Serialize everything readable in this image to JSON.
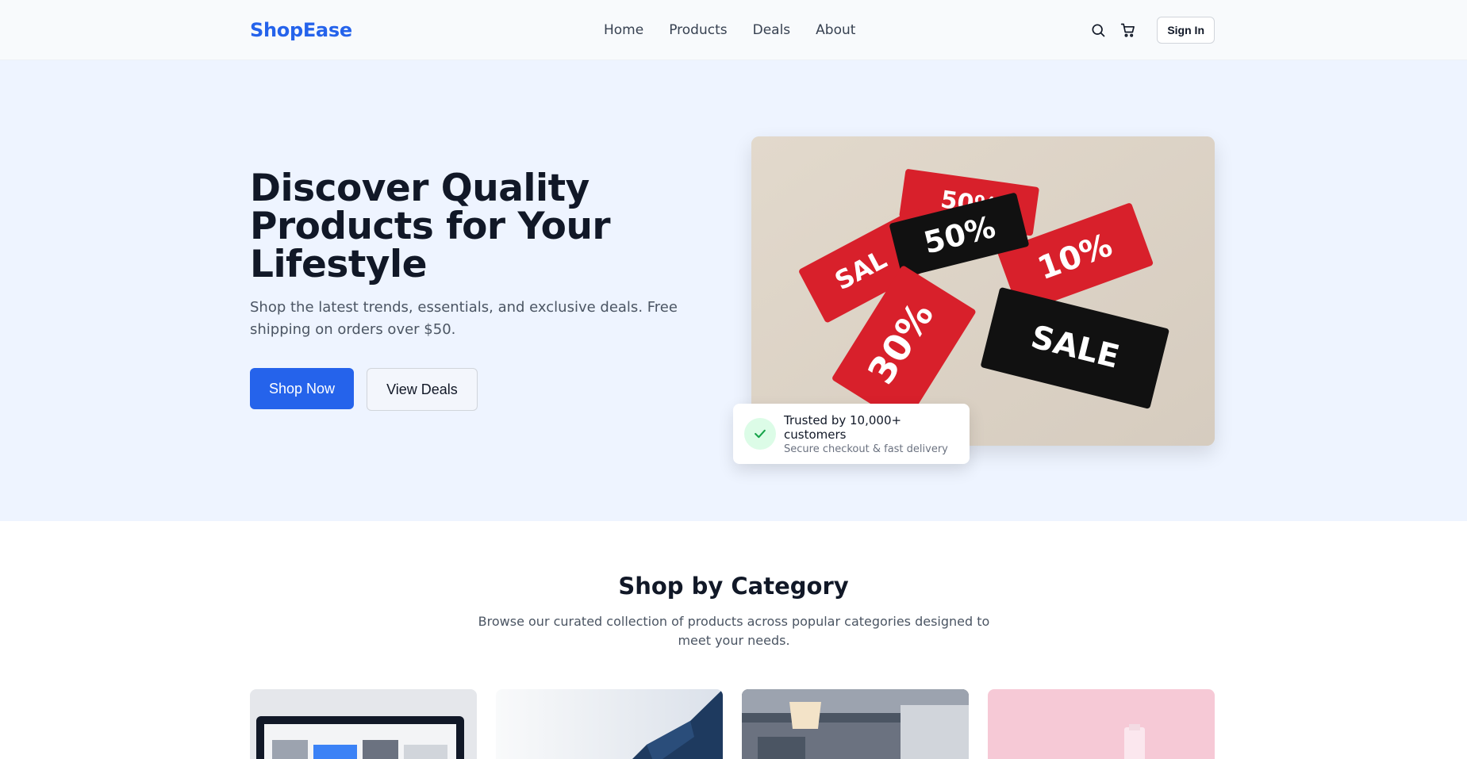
{
  "header": {
    "logo": "ShopEase",
    "nav": [
      "Home",
      "Products",
      "Deals",
      "About"
    ],
    "search_icon": "search-icon",
    "cart_icon": "cart-icon",
    "signin_label": "Sign In"
  },
  "hero": {
    "title": "Discover Quality Products for Your Lifestyle",
    "subtitle": "Shop the latest trends, essentials, and exclusive deals. Free shipping on orders over $50.",
    "primary_button": "Shop Now",
    "secondary_button": "View Deals",
    "image_tags": [
      "50%",
      "50%",
      "SAL",
      "10%",
      "30%",
      "SALE"
    ],
    "trust": {
      "icon": "check-icon",
      "title": "Trusted by 10,000+ customers",
      "subtitle": "Secure checkout & fast delivery"
    }
  },
  "categories": {
    "title": "Shop by Category",
    "subtitle": "Browse our curated collection of products across popular categories designed to meet your needs.",
    "cards": [
      "electronics",
      "fashion",
      "home",
      "beauty"
    ]
  },
  "colors": {
    "brand": "#2563eb",
    "hero_bg": "#eef4ff",
    "success": "#16a34a"
  }
}
